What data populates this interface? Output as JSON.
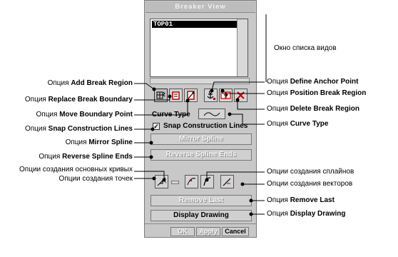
{
  "panel": {
    "title": "Breaker View",
    "list_item": "TOP01",
    "curve_type_label": "Curve Type",
    "snap_label": "Snap Construction Lines",
    "mirror_button": "Mirror Spline",
    "reverse_button": "Reverse Spline Ends",
    "remove_last_button": "Remove Last",
    "display_drawing_button": "Display Drawing",
    "ok_button": "OK",
    "apply_button": "Apply",
    "cancel_button": "Cancel"
  },
  "labels_left": {
    "add_break": {
      "prefix": "Опция ",
      "bold": "Add Break Region"
    },
    "replace_boundary": {
      "prefix": "Опция ",
      "bold": "Replace Break Boundary"
    },
    "move_boundary": {
      "prefix": "Опция ",
      "bold": "Move Boundary Point"
    },
    "snap": {
      "prefix": "Опция ",
      "bold": "Snap Construction Lines"
    },
    "mirror": {
      "prefix": "Опция ",
      "bold": "Mirror Spline"
    },
    "reverse": {
      "prefix": "Опция ",
      "bold": "Reverse Spline Ends"
    },
    "basic_curves": "Опции создания основных кривых",
    "points": "Опции создания точек"
  },
  "labels_right": {
    "list_window": "Окно списка видов",
    "define_anchor": {
      "prefix": "Опция ",
      "bold": "Define Anchor Point"
    },
    "position_break": {
      "prefix": "Опция ",
      "bold": "Position Break Region"
    },
    "delete_break": {
      "prefix": "Опция ",
      "bold": "Delete Break Region"
    },
    "curve_type": {
      "prefix": "Опция ",
      "bold": "Curve Type"
    },
    "spline": "Опции создания сплайнов",
    "vector": "Опции создания векторов",
    "remove_last": {
      "prefix": "Опция ",
      "bold": "Remove Last"
    },
    "display_drawing": {
      "prefix": "Опция ",
      "bold": "Display Drawing"
    }
  },
  "icons": [
    "add-break-icon",
    "replace-boundary-icon",
    "move-boundary-icon",
    "anchor-icon",
    "position-break-icon",
    "delete-break-icon",
    "curve-wave-icon",
    "point-icon",
    "line-icon",
    "spline-point-icon",
    "spline-curve-icon",
    "vector-icon"
  ]
}
